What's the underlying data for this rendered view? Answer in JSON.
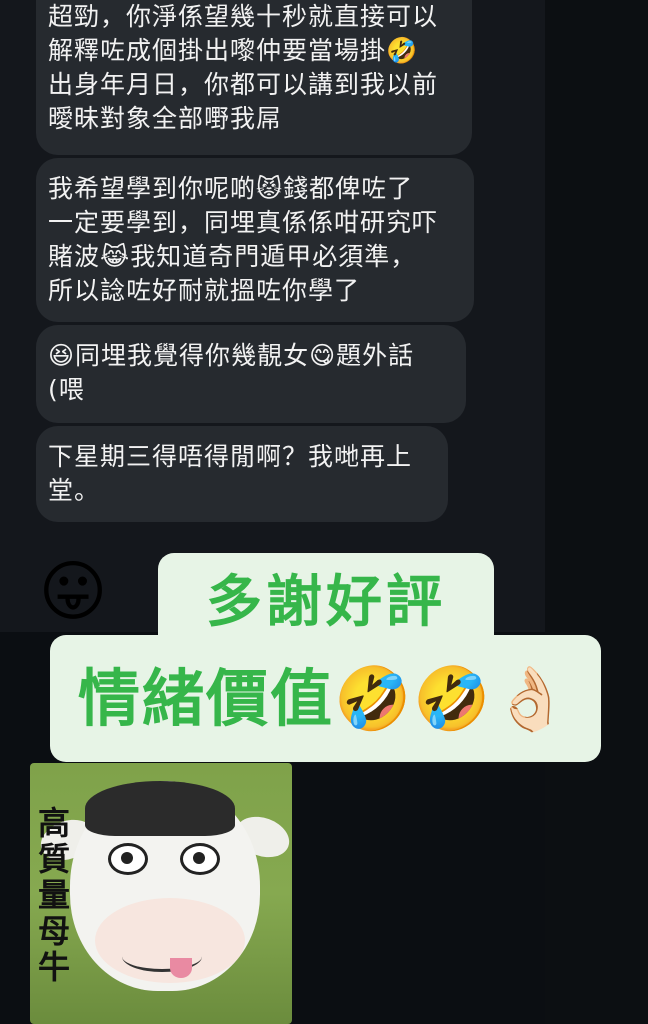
{
  "messages": [
    {
      "id": 1,
      "text": "超勁，你淨係望幾十秒就直接可以\n解釋咗成個掛出嚟仲要當場掛🤣\n出身年月日，你都可以講到我以前\n曖昧對象全部嘢我屌"
    },
    {
      "id": 2,
      "text": "我希望學到你呢啲😾錢都俾咗了\n一定要學到，同埋真係係咁研究吓\n賭波😹我知道奇門遁甲必須準，\n所以諗咗好耐就搵咗你學了"
    },
    {
      "id": 3,
      "text": "😆同埋我覺得你幾靚女😋題外話\n(喂"
    },
    {
      "id": 4,
      "text": "下星期三得唔得閒啊？我哋再上\n堂。"
    }
  ],
  "reaction_emoji": "😛",
  "captions": {
    "top": "多謝好評",
    "bottom": "情緒價值🤣🤣👌🏻"
  },
  "sticker": {
    "text": "高質量母牛"
  },
  "colors": {
    "background": "#0b0e12",
    "bubble": "#262a2f",
    "caption_bg": "#e7f4e6",
    "caption_text": "#36b64a"
  }
}
